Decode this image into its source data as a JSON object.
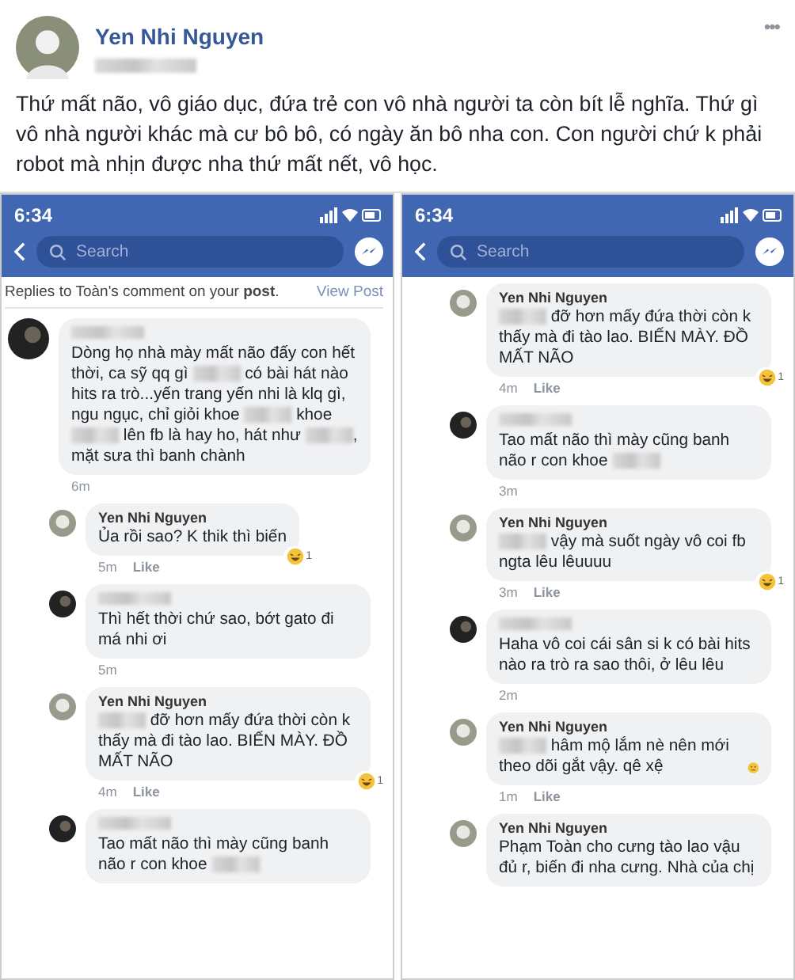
{
  "post": {
    "author": "Yen Nhi Nguyen",
    "menu": "•••",
    "text": "Thứ mất não, vô giáo dục, đứa trẻ con vô nhà người ta còn bít lễ nghĩa. Thứ gì vô nhà người khác mà cư bô bô, có ngày ăn bô nha con. Con người chứ k phải robot mà nhịn được nha thứ mất nết, vô học."
  },
  "screenshots": [
    {
      "status_time": "6:34",
      "search_placeholder": "Search",
      "context": {
        "text": "Replies to Toàn's comment on your **post**.",
        "link": "View Post"
      },
      "comments": [
        {
          "kind": "top",
          "body": [
            {
              "text": "Dòng họ nhà mày mất não đấy con hết thời, ca sỹ qq gì "
            },
            {
              "kind": "blur"
            },
            {
              "text": " có bài hát nào hits ra trò...yến trang yến nhi là klq gì, ngu ngục, chỉ giỏi khoe "
            },
            {
              "kind": "blur"
            },
            {
              "text": " khoe "
            },
            {
              "kind": "blur"
            },
            {
              "text": " lên fb là hay ho, hát như "
            },
            {
              "kind": "blur"
            },
            {
              "text": ", mặt sưa thì banh chành"
            }
          ],
          "time": "6m"
        },
        {
          "kind": "reply",
          "author": "Yen Nhi Nguyen",
          "body": [
            {
              "text": "Ủa rồi sao? K thik thì biến"
            }
          ],
          "time": "5m",
          "like": "Like",
          "reaction_count": "1"
        },
        {
          "kind": "reply",
          "body": [
            {
              "text": "Thì hết thời chứ sao, bớt gato đi má nhi ơi"
            }
          ],
          "time": "5m"
        },
        {
          "kind": "reply",
          "author": "Yen Nhi Nguyen",
          "body": [
            {
              "kind": "blur"
            },
            {
              "text": " đỡ hơn mấy đứa thời còn k thấy mà đi tào lao. BIẾN MÀY. ĐỒ MẤT NÃO"
            }
          ],
          "time": "4m",
          "like": "Like",
          "reaction_count": "1"
        },
        {
          "kind": "reply",
          "body": [
            {
              "text": "Tao mất não thì mày cũng banh não r con khoe "
            },
            {
              "kind": "blur"
            }
          ]
        }
      ]
    },
    {
      "status_time": "6:34",
      "search_placeholder": "Search",
      "comments": [
        {
          "kind": "reply",
          "author": "Yen Nhi Nguyen",
          "body": [
            {
              "kind": "blur"
            },
            {
              "text": " đỡ hơn mấy đứa thời còn k thấy mà đi tào lao. BIẾN MÀY. ĐỒ MẤT NÃO"
            }
          ],
          "time": "4m",
          "like": "Like",
          "reaction_count": "1"
        },
        {
          "kind": "reply",
          "body": [
            {
              "text": "Tao mất não thì mày cũng banh não r con khoe "
            },
            {
              "kind": "blur"
            }
          ],
          "time": "3m"
        },
        {
          "kind": "reply",
          "author": "Yen Nhi Nguyen",
          "body": [
            {
              "kind": "blur"
            },
            {
              "text": " vậy mà suốt ngày vô coi fb ngta lêu lêuuuu"
            }
          ],
          "time": "3m",
          "like": "Like",
          "reaction_count": "1"
        },
        {
          "kind": "reply",
          "body": [
            {
              "text": "Haha vô coi cái sân si k có bài hits nào ra trò ra sao thôi, ở lêu lêu"
            }
          ],
          "time": "2m"
        },
        {
          "kind": "reply",
          "author": "Yen Nhi Nguyen",
          "body": [
            {
              "kind": "blur"
            },
            {
              "text": " hâm mộ lắm nè nên mới theo dõi gắt vậy. qê xệ"
            },
            {
              "kind": "emoji"
            }
          ],
          "time": "1m",
          "like": "Like"
        },
        {
          "kind": "reply",
          "author": "Yen Nhi Nguyen",
          "body": [
            {
              "text": "Phạm Toàn cho cưng tào lao vậu đủ r, biến đi nha cưng. Nhà của chị"
            }
          ]
        }
      ]
    }
  ]
}
